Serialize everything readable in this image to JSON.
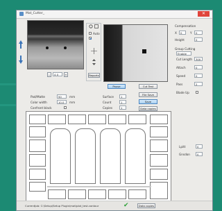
{
  "window": {
    "title": "Mat_Cutter_",
    "close_glyph": "✕"
  },
  "camera": {
    "frame_field": "4 0",
    "zoom_minus": "-",
    "zoom_plus": "+"
  },
  "options": {
    "auto_label": "Auto",
    "preview_button": "Reports"
  },
  "buttons": {
    "pause": "Pause",
    "cut_test": "Cut Test",
    "file_save": "File Save",
    "save": "Save",
    "data_copies": "Data copies"
  },
  "left_fields": {
    "rows": [
      {
        "label": "Pad/Matte",
        "value": "50",
        "unit": "mm"
      },
      {
        "label": "Color width",
        "value": "10.0",
        "unit": "mm"
      },
      {
        "label": "Confront black",
        "value": "",
        "unit": ""
      }
    ]
  },
  "mid_fields": {
    "rows": [
      {
        "label": "Surface",
        "value": "1"
      },
      {
        "label": "Count",
        "value": "1"
      },
      {
        "label": "Copies",
        "value": "1"
      }
    ]
  },
  "compensation": {
    "header": "Compensation",
    "x_label": "X",
    "x_value": "0",
    "y_label": "Y",
    "y_value": "0",
    "height_label": "Height",
    "height_value": "0"
  },
  "cutting": {
    "header": "Group Cutting",
    "mode_value": "Enable",
    "rows": [
      {
        "label": "Cut Length",
        "value": "300"
      },
      {
        "label": "Attach",
        "value": "0"
      },
      {
        "label": "Speed",
        "value": "0"
      },
      {
        "label": "Pass",
        "value": "2"
      },
      {
        "label": "Blade Up",
        "value": ""
      }
    ]
  },
  "bottom_fields": {
    "rows": [
      {
        "label": "Lpitt",
        "value": "0"
      },
      {
        "label": "Gnsdon",
        "value": "0"
      }
    ]
  },
  "status": {
    "path_text": "CurrentJob: C:\\Setup\\Setup Plugin\\mat\\plot_test.contour",
    "ok_glyph": "✔",
    "end_button": "Data copies"
  },
  "colors": {
    "desktop": "#1c8a73",
    "accent": "#3b74b8",
    "ok_green": "#2fa23a"
  }
}
